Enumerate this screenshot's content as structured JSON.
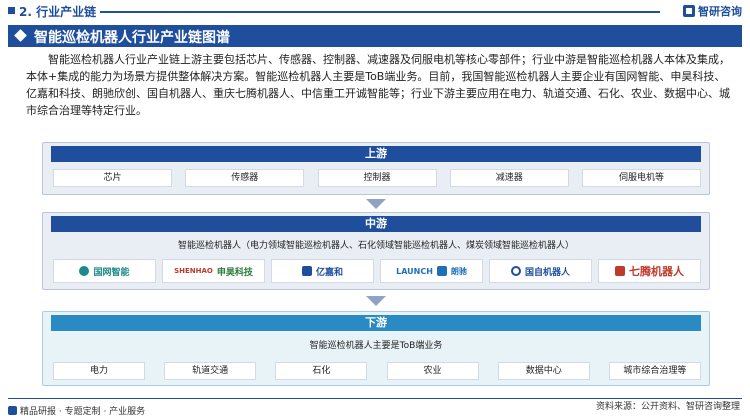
{
  "header": {
    "section": "2. 行业产业链",
    "brand": "智研咨询"
  },
  "title": "智能巡检机器人行业产业链图谱",
  "intro": "智能巡检机器人行业产业链上游主要包括芯片、传感器、控制器、减速器及伺服电机等核心零部件；行业中游是智能巡检机器人本体及集成，本体+集成的能力为场景方提供整体解决方案。智能巡检机器人主要是ToB端业务。目前，我国智能巡检机器人主要企业有国网智能、申昊科技、亿嘉和科技、朗驰欣创、国自机器人、重庆七腾机器人、中信重工开诚智能等；行业下游主要应用在电力、轨道交通、石化、农业、数据中心、城市综合治理等特定行业。",
  "upstream": {
    "label": "上游",
    "items": [
      "芯片",
      "传感器",
      "控制器",
      "减速器",
      "伺服电机等"
    ]
  },
  "midstream": {
    "label": "中游",
    "subtitle": "智能巡检机器人（电力领域智能巡检机器人、石化领域智能巡检机器人、煤炭领域智能巡检机器人）",
    "logos": [
      {
        "text": "国网智能",
        "icon": "state-grid-logo"
      },
      {
        "text": "申昊科技",
        "prefix": "SHENHAO",
        "icon": "shenhao-logo"
      },
      {
        "text": "亿嘉和",
        "icon": "yijiahe-logo"
      },
      {
        "text": "朗驰",
        "prefix": "LAUNCH",
        "icon": "launch-logo"
      },
      {
        "text": "国自机器人",
        "icon": "guozi-logo"
      },
      {
        "text": "七腾机器人",
        "icon": "qiteng-logo"
      }
    ]
  },
  "downstream": {
    "label": "下游",
    "subtitle": "智能巡检机器人主要是ToB端业务",
    "items": [
      "电力",
      "轨道交通",
      "石化",
      "农业",
      "数据中心",
      "城市综合治理等"
    ]
  },
  "footer": {
    "left": "精品研报 · 专题定制 · 产业服务",
    "right": "资料来源：公开资料、智研咨询整理"
  },
  "colors": {
    "primary": "#1f4e9c",
    "downstream": "#2a8ac4",
    "panel_bg": "#e9edf4"
  }
}
